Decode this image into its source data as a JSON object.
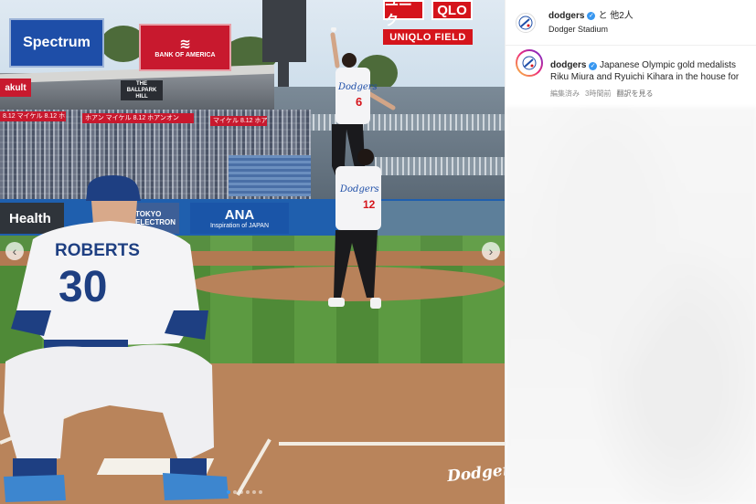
{
  "photo": {
    "signs": {
      "spectrum": "Spectrum",
      "bank_of_america": "BANK OF AMERICA",
      "bank_flag": "≋",
      "ballpark": "akult",
      "hill": "THE BALLPARK HILL",
      "uniqlo_a": "ユニク",
      "uniqlo_b": "QLO",
      "uniqlo_field": "UNIQLO FIELD",
      "ribbon_left": "8.12 マイケル 8.12 ホアン",
      "ribbon_mid": "ホアン マイケル 8.12 ホアンオン",
      "ribbon_right": "マイケル 8.12 ホアン"
    },
    "wall_ads": {
      "health": "Health",
      "tokyo_electron": "TOKYO ELECTRON",
      "ana": "ANA",
      "ana_sub": "Inspiration of JAPAN"
    },
    "catcher": {
      "name": "ROBERTS",
      "number": "30"
    },
    "performer_jersey": {
      "script": "Dodgers",
      "number": "6"
    },
    "lifter_jersey": {
      "script": "Dodgers",
      "number": "12"
    },
    "watermark": "Dodgers",
    "carousel": {
      "prev_icon": "‹",
      "next_icon": "›",
      "dots": 6,
      "active_dot": 0
    }
  },
  "post": {
    "username": "dodgers",
    "with_text": "と 他2人",
    "location": "Dodger Stadium",
    "caption_username": "dodgers",
    "caption_text": "Japanese Olympic gold medalists Riku Miura and Ryuichi Kihara in the house for tonight's honorary first pitch!",
    "edited": "編集済み",
    "time_ago": "3時間前",
    "see_translation": "翻訳を見る",
    "verified_icon": "✓"
  },
  "colors": {
    "dodger_blue": "#1e4ea8",
    "verified_blue": "#3897f0",
    "uniqlo_red": "#d5141b"
  }
}
